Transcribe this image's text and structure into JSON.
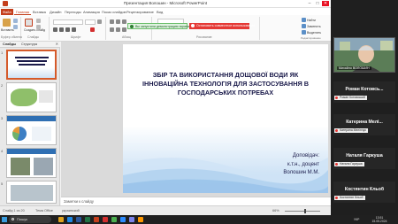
{
  "window": {
    "title": "Презентация Волошин - Microsoft PowerPoint",
    "controls": {
      "minimize": "–",
      "maximize": "□",
      "close": "✕"
    }
  },
  "tabs": [
    "Файл",
    "Главная",
    "Вставка",
    "Дизайн",
    "Переходы",
    "Анимация",
    "Показ слайдов",
    "Рецензирование",
    "Вид"
  ],
  "ribbon": {
    "groups": [
      "Буфер обмена",
      "Слайды",
      "Шрифт",
      "Абзац",
      "Рисование",
      "Редактирование"
    ],
    "paste_label": "Вставить",
    "create_slide_label": "Создать слайд",
    "find_label": "Найти",
    "replace_label": "Заменить",
    "select_label": "Выделить"
  },
  "share_bar": {
    "sharing_text": "Вы запустили демонстрацию экрана",
    "stop_text": "Остановить совместное использование"
  },
  "pane": {
    "tabs": [
      "Слайды",
      "Структура"
    ],
    "slide_numbers": [
      "1",
      "2",
      "3",
      "4",
      "5"
    ]
  },
  "slide": {
    "title": "ЗБІР ТА ВИКОРИСТАННЯ ДОЩОВОЇ ВОДИ ЯК ІННОВАЦІЙНА ТЕХНОЛОГІЯ ДЛЯ ЗАСТОСУВАННЯ В ГОСПОДАРСЬКИХ ПОТРЕБАХ",
    "speaker_lines": [
      "Доповідач:",
      "к.т.н., доцент",
      "Волошин М.М."
    ]
  },
  "notes": {
    "placeholder": "Заметки к слайду"
  },
  "status": {
    "slide_info": "Слайд 1 из 20",
    "theme": "Тема Office",
    "language": "украинский",
    "zoom": "66%"
  },
  "meeting": {
    "self_name": "Михайло ВОЛОШИН",
    "participants": [
      {
        "display": "Роман Котовсь...",
        "label": "Роман Котовський"
      },
      {
        "display": "Катерина Мелі...",
        "label": "Катерина Мелінчук"
      },
      {
        "display": "Наталя Гаркуша",
        "label": "Наталя Гаркуша"
      },
      {
        "display": "Костянтин Кльоб",
        "label": "Костянтин Кльоб"
      }
    ]
  },
  "taskbar": {
    "search_placeholder": "Пошук",
    "tray_lang": "УКР",
    "time": "13:51",
    "date": "15.05.2024"
  },
  "colors": {
    "ppt_accent": "#c43e1c",
    "share_green": "#6cbf6c",
    "stop_red": "#e53935",
    "slide_title": "#1a1a4a",
    "panel_bg": "#1f1f1f"
  }
}
